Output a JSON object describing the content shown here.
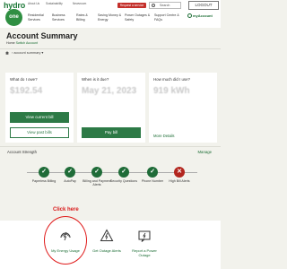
{
  "header": {
    "logo_top": "hydro",
    "logo_circle": "one",
    "utility_links": [
      "About Us",
      "Sustainability",
      "Newsroom"
    ],
    "service_button": "Request a service",
    "search_placeholder": "Search",
    "logout": "LOGOUT",
    "my_account": "myAccount",
    "nav": [
      {
        "line1": "Residential",
        "line2": "Services"
      },
      {
        "line1": "Business",
        "line2": "Services"
      },
      {
        "line1": "Rates &",
        "line2": "Billing"
      },
      {
        "line1": "Saving Money &",
        "line2": "Energy"
      },
      {
        "line1": "Power Outages &",
        "line2": "Safety"
      },
      {
        "line1": "Support Centre &",
        "line2": "FAQs"
      }
    ]
  },
  "page": {
    "title": "Account Summary",
    "breadcrumb_home": "Home",
    "breadcrumb_current": "Switch Account",
    "account_selector": "account summary"
  },
  "cards": {
    "owe": {
      "heading": "What do I owe?",
      "value": "$192.54",
      "primary": "View current bill",
      "secondary": "View past bills"
    },
    "due": {
      "heading": "When is it due?",
      "value": "May 21, 2023",
      "primary": "Pay bill"
    },
    "usage": {
      "heading": "How much did I use?",
      "value": "919 kWh",
      "link": "More Details"
    }
  },
  "strength": {
    "title": "Account Strength",
    "manage": "Manage",
    "check_glyph": "✓",
    "bad_glyph": "✕",
    "steps": [
      {
        "label": "Paperless Billing"
      },
      {
        "label": "AutoPay"
      },
      {
        "label": "Billing and Payment Alerts"
      },
      {
        "label": "Security Questions"
      },
      {
        "label": "Phone Number"
      },
      {
        "label": "High Bill Alerts"
      }
    ]
  },
  "annotation": {
    "text": "Click here"
  },
  "quick_links": [
    {
      "label": "My Energy Usage",
      "icon": "energy-usage-icon"
    },
    {
      "label": "Get Outage Alerts",
      "icon": "outage-alert-icon"
    },
    {
      "label": "Report a Power Outage",
      "icon": "report-outage-icon"
    }
  ],
  "colors": {
    "brand_green": "#2d7a46",
    "alert_red": "#b3261e",
    "annotation_red": "#d91a1a"
  }
}
